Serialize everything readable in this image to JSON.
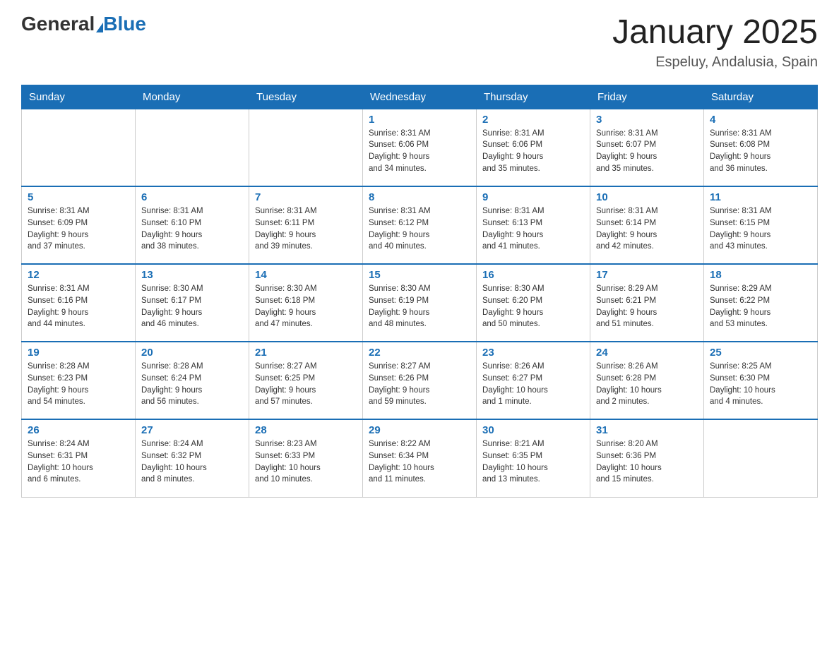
{
  "header": {
    "logo_general": "General",
    "logo_blue": "Blue",
    "month_title": "January 2025",
    "location": "Espeluy, Andalusia, Spain"
  },
  "days_of_week": [
    "Sunday",
    "Monday",
    "Tuesday",
    "Wednesday",
    "Thursday",
    "Friday",
    "Saturday"
  ],
  "weeks": [
    [
      {
        "day": "",
        "info": ""
      },
      {
        "day": "",
        "info": ""
      },
      {
        "day": "",
        "info": ""
      },
      {
        "day": "1",
        "info": "Sunrise: 8:31 AM\nSunset: 6:06 PM\nDaylight: 9 hours\nand 34 minutes."
      },
      {
        "day": "2",
        "info": "Sunrise: 8:31 AM\nSunset: 6:06 PM\nDaylight: 9 hours\nand 35 minutes."
      },
      {
        "day": "3",
        "info": "Sunrise: 8:31 AM\nSunset: 6:07 PM\nDaylight: 9 hours\nand 35 minutes."
      },
      {
        "day": "4",
        "info": "Sunrise: 8:31 AM\nSunset: 6:08 PM\nDaylight: 9 hours\nand 36 minutes."
      }
    ],
    [
      {
        "day": "5",
        "info": "Sunrise: 8:31 AM\nSunset: 6:09 PM\nDaylight: 9 hours\nand 37 minutes."
      },
      {
        "day": "6",
        "info": "Sunrise: 8:31 AM\nSunset: 6:10 PM\nDaylight: 9 hours\nand 38 minutes."
      },
      {
        "day": "7",
        "info": "Sunrise: 8:31 AM\nSunset: 6:11 PM\nDaylight: 9 hours\nand 39 minutes."
      },
      {
        "day": "8",
        "info": "Sunrise: 8:31 AM\nSunset: 6:12 PM\nDaylight: 9 hours\nand 40 minutes."
      },
      {
        "day": "9",
        "info": "Sunrise: 8:31 AM\nSunset: 6:13 PM\nDaylight: 9 hours\nand 41 minutes."
      },
      {
        "day": "10",
        "info": "Sunrise: 8:31 AM\nSunset: 6:14 PM\nDaylight: 9 hours\nand 42 minutes."
      },
      {
        "day": "11",
        "info": "Sunrise: 8:31 AM\nSunset: 6:15 PM\nDaylight: 9 hours\nand 43 minutes."
      }
    ],
    [
      {
        "day": "12",
        "info": "Sunrise: 8:31 AM\nSunset: 6:16 PM\nDaylight: 9 hours\nand 44 minutes."
      },
      {
        "day": "13",
        "info": "Sunrise: 8:30 AM\nSunset: 6:17 PM\nDaylight: 9 hours\nand 46 minutes."
      },
      {
        "day": "14",
        "info": "Sunrise: 8:30 AM\nSunset: 6:18 PM\nDaylight: 9 hours\nand 47 minutes."
      },
      {
        "day": "15",
        "info": "Sunrise: 8:30 AM\nSunset: 6:19 PM\nDaylight: 9 hours\nand 48 minutes."
      },
      {
        "day": "16",
        "info": "Sunrise: 8:30 AM\nSunset: 6:20 PM\nDaylight: 9 hours\nand 50 minutes."
      },
      {
        "day": "17",
        "info": "Sunrise: 8:29 AM\nSunset: 6:21 PM\nDaylight: 9 hours\nand 51 minutes."
      },
      {
        "day": "18",
        "info": "Sunrise: 8:29 AM\nSunset: 6:22 PM\nDaylight: 9 hours\nand 53 minutes."
      }
    ],
    [
      {
        "day": "19",
        "info": "Sunrise: 8:28 AM\nSunset: 6:23 PM\nDaylight: 9 hours\nand 54 minutes."
      },
      {
        "day": "20",
        "info": "Sunrise: 8:28 AM\nSunset: 6:24 PM\nDaylight: 9 hours\nand 56 minutes."
      },
      {
        "day": "21",
        "info": "Sunrise: 8:27 AM\nSunset: 6:25 PM\nDaylight: 9 hours\nand 57 minutes."
      },
      {
        "day": "22",
        "info": "Sunrise: 8:27 AM\nSunset: 6:26 PM\nDaylight: 9 hours\nand 59 minutes."
      },
      {
        "day": "23",
        "info": "Sunrise: 8:26 AM\nSunset: 6:27 PM\nDaylight: 10 hours\nand 1 minute."
      },
      {
        "day": "24",
        "info": "Sunrise: 8:26 AM\nSunset: 6:28 PM\nDaylight: 10 hours\nand 2 minutes."
      },
      {
        "day": "25",
        "info": "Sunrise: 8:25 AM\nSunset: 6:30 PM\nDaylight: 10 hours\nand 4 minutes."
      }
    ],
    [
      {
        "day": "26",
        "info": "Sunrise: 8:24 AM\nSunset: 6:31 PM\nDaylight: 10 hours\nand 6 minutes."
      },
      {
        "day": "27",
        "info": "Sunrise: 8:24 AM\nSunset: 6:32 PM\nDaylight: 10 hours\nand 8 minutes."
      },
      {
        "day": "28",
        "info": "Sunrise: 8:23 AM\nSunset: 6:33 PM\nDaylight: 10 hours\nand 10 minutes."
      },
      {
        "day": "29",
        "info": "Sunrise: 8:22 AM\nSunset: 6:34 PM\nDaylight: 10 hours\nand 11 minutes."
      },
      {
        "day": "30",
        "info": "Sunrise: 8:21 AM\nSunset: 6:35 PM\nDaylight: 10 hours\nand 13 minutes."
      },
      {
        "day": "31",
        "info": "Sunrise: 8:20 AM\nSunset: 6:36 PM\nDaylight: 10 hours\nand 15 minutes."
      },
      {
        "day": "",
        "info": ""
      }
    ]
  ]
}
